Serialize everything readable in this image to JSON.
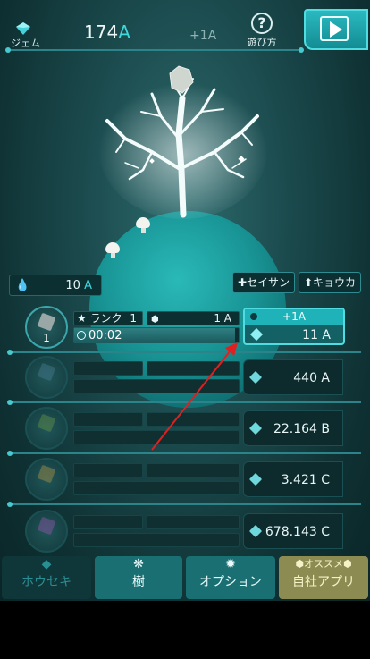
{
  "header": {
    "gem_label": "ジェム",
    "currency_value": "174",
    "currency_unit": "A",
    "rate": "+1A",
    "help_label": "遊び方",
    "help_symbol": "?"
  },
  "controls": {
    "water_value": "10",
    "water_unit": "A",
    "grow_button": "セイサン",
    "strengthen_button": "キョウカ"
  },
  "rows": [
    {
      "rank_label": "ランク",
      "rank_value": "1",
      "income": "1 A",
      "level": "1",
      "timer": "00:02",
      "timer_progress": 0.98,
      "bonus": "+1A",
      "cost": "11 A",
      "gem_color": "#9aa7a7"
    },
    {
      "cost": "440 A",
      "gem_color": "#4a7f95"
    },
    {
      "cost": "22.164 B",
      "gem_color": "#6a9a4a"
    },
    {
      "cost": "3.421 C",
      "gem_color": "#b59a4a"
    },
    {
      "cost": "678.143 C",
      "gem_color": "#9a5ab5"
    }
  ],
  "tabs": [
    {
      "label": "ホウセキ",
      "icon": "diamond-icon"
    },
    {
      "label": "樹",
      "icon": "tree-icon"
    },
    {
      "label": "オプション",
      "icon": "gear-icon"
    },
    {
      "label": "自社アプリ",
      "badge": "オススメ",
      "icon": "hexagon-icon"
    }
  ],
  "colors": {
    "accent": "#3fd6dc",
    "background": "#1b4a4d",
    "recommend_tab": "#8c8b52"
  }
}
